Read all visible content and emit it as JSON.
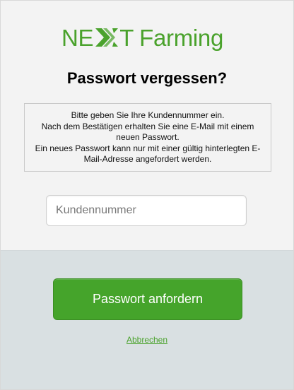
{
  "brand": {
    "logo_prefix": "NE",
    "logo_t": "T",
    "logo_suffix": "Farming",
    "color": "#4aa22c"
  },
  "page": {
    "title": "Passwort vergessen?"
  },
  "info": {
    "lines": [
      "Bitte geben Sie Ihre Kundennummer ein.",
      "Nach dem Bestätigen erhalten Sie eine E-Mail mit einem neuen Passwort.",
      "Ein neues Passwort kann nur mit einer gültig hinterlegten E-Mail-Adresse angefordert werden."
    ]
  },
  "form": {
    "customer_number": {
      "value": "",
      "placeholder": "Kundennummer"
    },
    "submit_label": "Passwort anfordern",
    "cancel_label": "Abbrechen"
  },
  "colors": {
    "accent": "#45a42b",
    "top_background": "#f3f3f3",
    "bottom_background": "#d9e0e2"
  },
  "icons": {
    "logo_mark": "double-chevron-x-logo-mark"
  }
}
